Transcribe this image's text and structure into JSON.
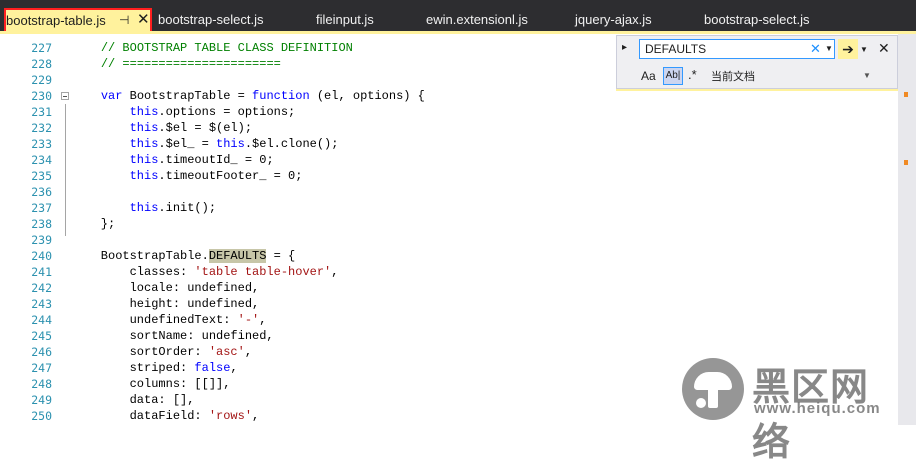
{
  "tabs": [
    {
      "label": "bootstrap-table.js",
      "active": true
    },
    {
      "label": "bootstrap-select.js"
    },
    {
      "label": "fileinput.js"
    },
    {
      "label": "ewin.extensionl.js"
    },
    {
      "label": "jquery-ajax.js"
    },
    {
      "label": "bootstrap-select.js"
    }
  ],
  "tab_pin_glyph": "⊣",
  "tab_close_glyph": "✕",
  "find": {
    "query": "DEFAULTS",
    "match_case_label": "Aa",
    "whole_word_label": "Ab|",
    "regex_label": ".*",
    "scope": "当前文档"
  },
  "line_numbers": [
    "227",
    "228",
    "229",
    "230",
    "231",
    "232",
    "233",
    "234",
    "235",
    "236",
    "237",
    "238",
    "239",
    "240",
    "241",
    "242",
    "243",
    "244",
    "245",
    "246",
    "247",
    "248",
    "249",
    "250"
  ],
  "code_lines": [
    [
      {
        "t": "    "
      },
      {
        "t": "// BOOTSTRAP TABLE CLASS DEFINITION",
        "c": "cm"
      }
    ],
    [
      {
        "t": "    "
      },
      {
        "t": "// ======================",
        "c": "cm"
      }
    ],
    [
      {
        "t": ""
      }
    ],
    [
      {
        "t": "    "
      },
      {
        "t": "var",
        "c": "kw"
      },
      {
        "t": " BootstrapTable = "
      },
      {
        "t": "function",
        "c": "kw"
      },
      {
        "t": " (el, options) {"
      }
    ],
    [
      {
        "t": "        "
      },
      {
        "t": "this",
        "c": "kw"
      },
      {
        "t": ".options = options;"
      }
    ],
    [
      {
        "t": "        "
      },
      {
        "t": "this",
        "c": "kw"
      },
      {
        "t": ".$el = $(el);"
      }
    ],
    [
      {
        "t": "        "
      },
      {
        "t": "this",
        "c": "kw"
      },
      {
        "t": ".$el_ = "
      },
      {
        "t": "this",
        "c": "kw"
      },
      {
        "t": ".$el.clone();"
      }
    ],
    [
      {
        "t": "        "
      },
      {
        "t": "this",
        "c": "kw"
      },
      {
        "t": ".timeoutId_ = 0;"
      }
    ],
    [
      {
        "t": "        "
      },
      {
        "t": "this",
        "c": "kw"
      },
      {
        "t": ".timeoutFooter_ = 0;"
      }
    ],
    [
      {
        "t": ""
      }
    ],
    [
      {
        "t": "        "
      },
      {
        "t": "this",
        "c": "kw"
      },
      {
        "t": ".init();"
      }
    ],
    [
      {
        "t": "    };"
      }
    ],
    [
      {
        "t": ""
      }
    ],
    [
      {
        "t": "    BootstrapTable."
      },
      {
        "t": "DEFAULTS",
        "c": "hl"
      },
      {
        "t": " = {"
      }
    ],
    [
      {
        "t": "        classes: "
      },
      {
        "t": "'table table-hover'",
        "c": "st"
      },
      {
        "t": ","
      }
    ],
    [
      {
        "t": "        locale: undefined,"
      }
    ],
    [
      {
        "t": "        height: undefined,"
      }
    ],
    [
      {
        "t": "        undefinedText: "
      },
      {
        "t": "'-'",
        "c": "st"
      },
      {
        "t": ","
      }
    ],
    [
      {
        "t": "        sortName: undefined,"
      }
    ],
    [
      {
        "t": "        sortOrder: "
      },
      {
        "t": "'asc'",
        "c": "st"
      },
      {
        "t": ","
      }
    ],
    [
      {
        "t": "        striped: "
      },
      {
        "t": "false",
        "c": "kw"
      },
      {
        "t": ","
      }
    ],
    [
      {
        "t": "        columns: [[]],"
      }
    ],
    [
      {
        "t": "        data: [],"
      }
    ],
    [
      {
        "t": "        dataField: "
      },
      {
        "t": "'rows'",
        "c": "st"
      },
      {
        "t": ","
      }
    ]
  ],
  "watermark": {
    "cn": "黑区网络",
    "url": "www.heiqu.com"
  },
  "colors": {
    "tab_bar": "#2d2d30",
    "active_tab": "#fff29d",
    "highlight_border": "#ff1f1f",
    "comment": "#008000",
    "keyword": "#0000ff",
    "string": "#a31515",
    "line_number": "#2b91af"
  }
}
